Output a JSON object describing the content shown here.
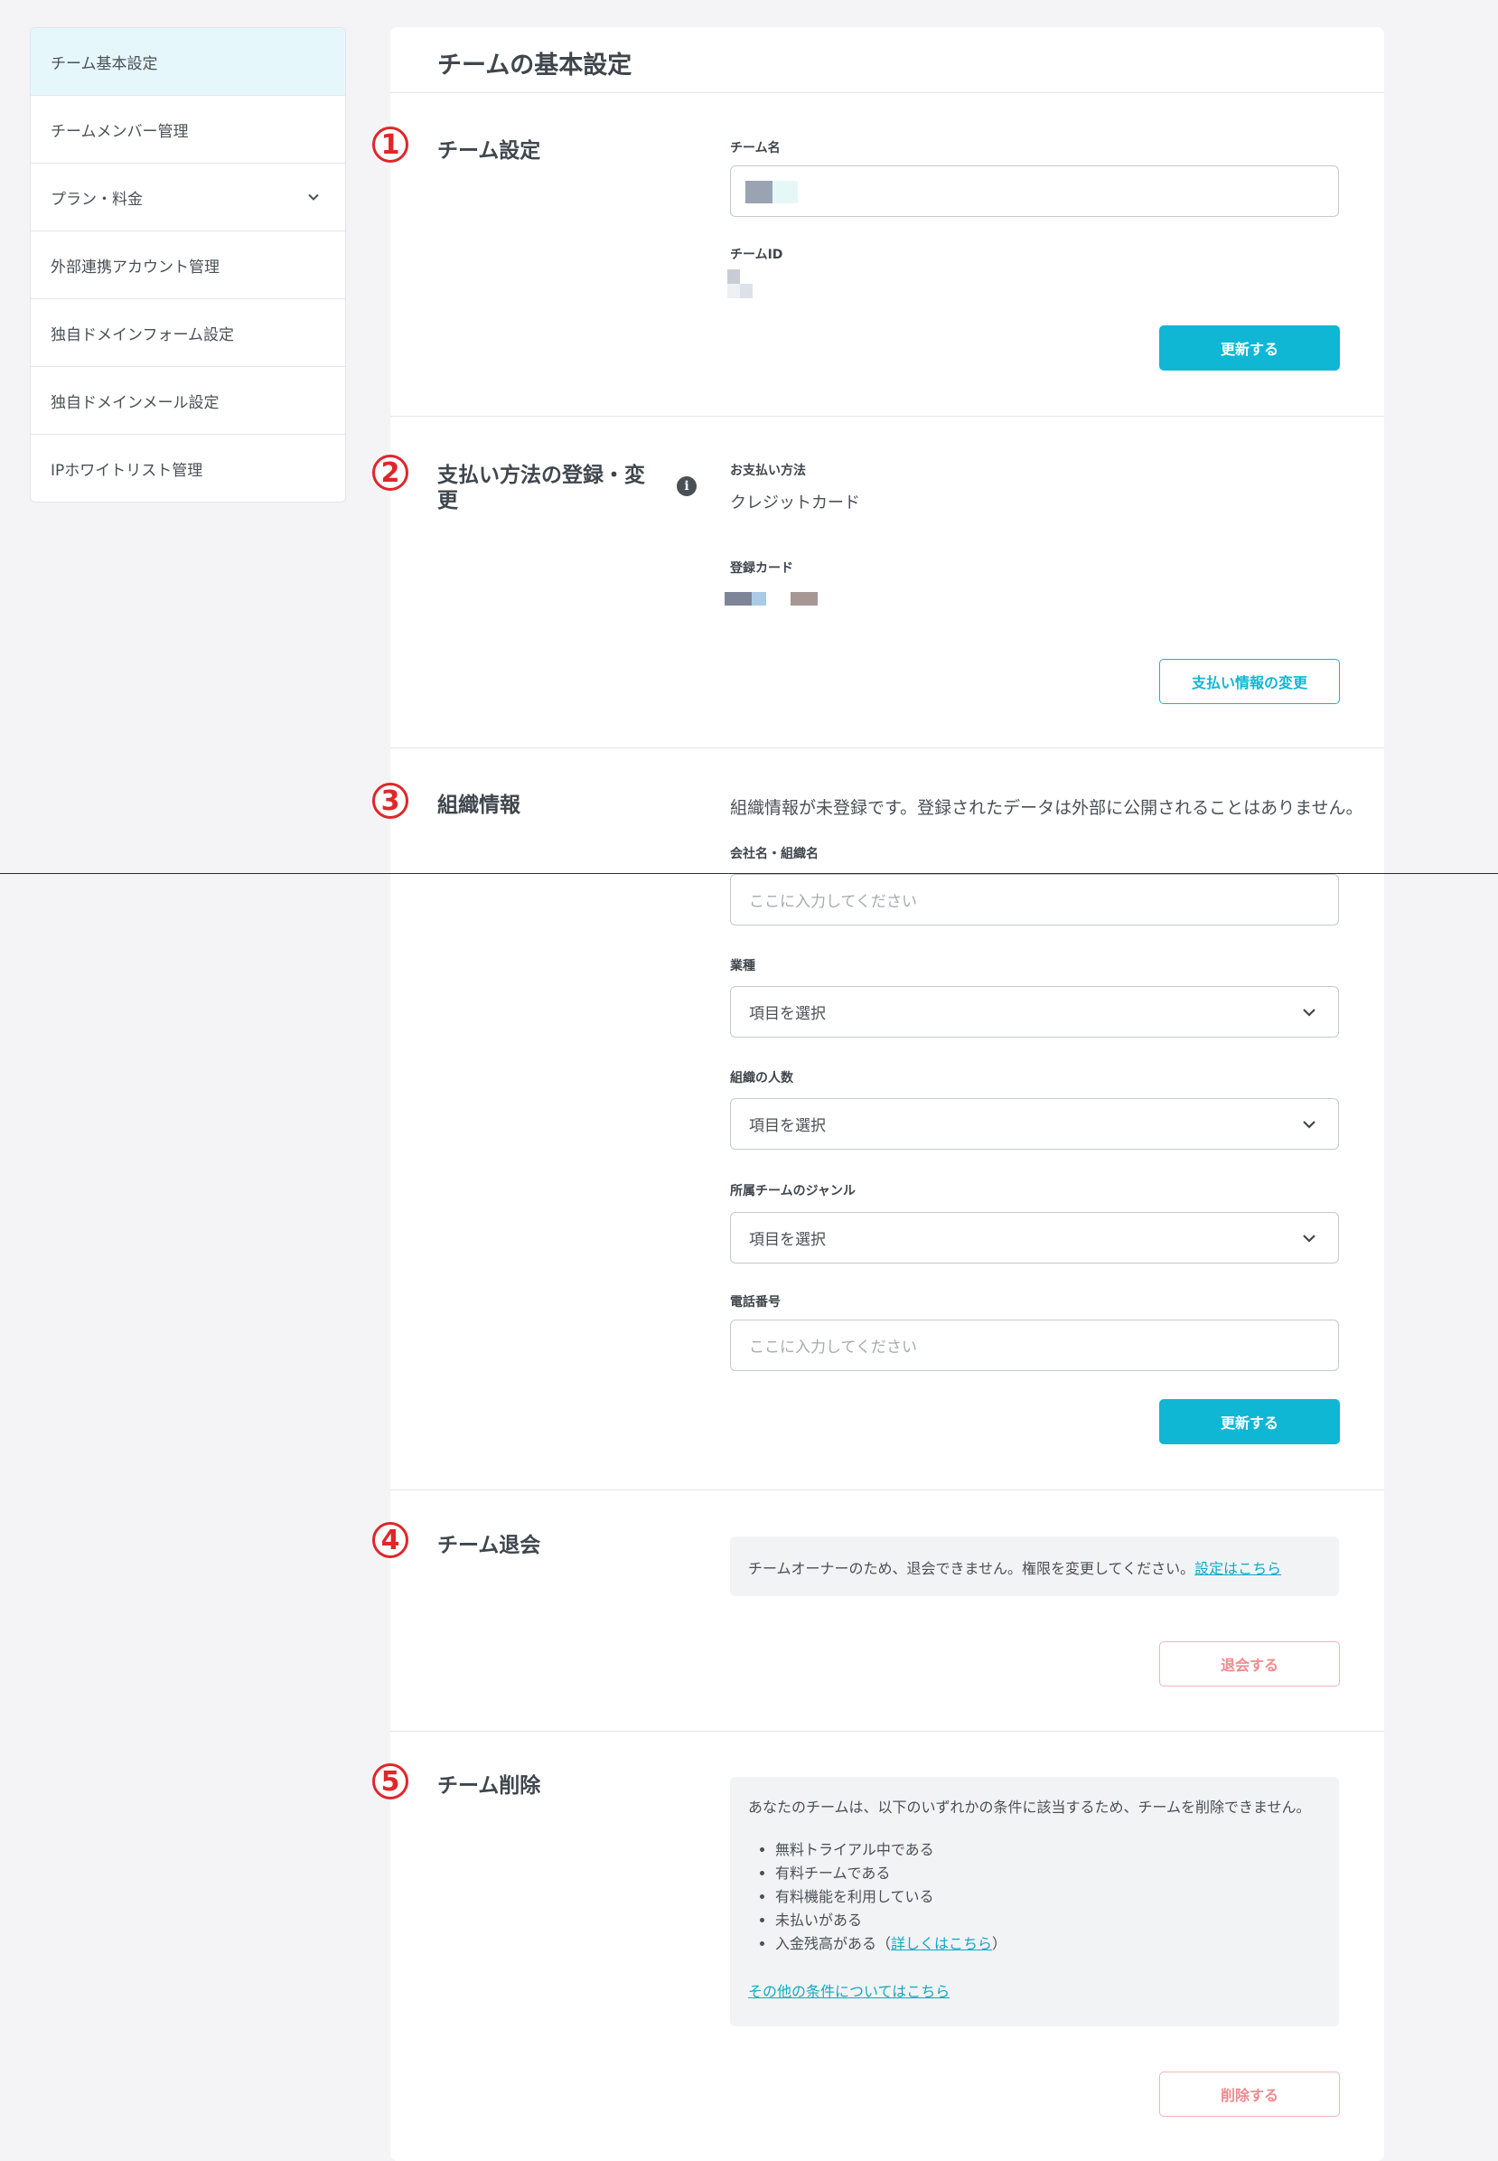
{
  "sidebar": {
    "items": [
      {
        "label": "チーム基本設定"
      },
      {
        "label": "チームメンバー管理"
      },
      {
        "label": "プラン・料金"
      },
      {
        "label": "外部連携アカウント管理"
      },
      {
        "label": "独自ドメインフォーム設定"
      },
      {
        "label": "独自ドメインメール設定"
      },
      {
        "label": "IPホワイトリスト管理"
      }
    ]
  },
  "page_title": "チームの基本設定",
  "markers": [
    "1",
    "2",
    "3",
    "4",
    "5"
  ],
  "team_settings": {
    "heading": "チーム設定",
    "name_label": "チーム名",
    "id_label": "チームID",
    "update_button": "更新する"
  },
  "payment": {
    "heading": "支払い方法の登録・変更",
    "info_icon": "i",
    "method_label": "お支払い方法",
    "method_value": "クレジットカード",
    "card_label": "登録カード",
    "change_button": "支払い情報の変更"
  },
  "organization": {
    "heading": "組織情報",
    "description": "組織情報が未登録です。登録されたデータは外部に公開されることはありません。",
    "company_label": "会社名・組織名",
    "company_placeholder": "ここに入力してください",
    "industry_label": "業種",
    "industry_value": "項目を選択",
    "size_label": "組織の人数",
    "size_value": "項目を選択",
    "genre_label": "所属チームのジャンル",
    "genre_value": "項目を選択",
    "phone_label": "電話番号",
    "phone_placeholder": "ここに入力してください",
    "update_button": "更新する"
  },
  "leave": {
    "heading": "チーム退会",
    "notice": "チームオーナーのため、退会できません。権限を変更してください。",
    "notice_link": "設定はこちら",
    "button": "退会する"
  },
  "delete": {
    "heading": "チーム削除",
    "notice": "あなたのチームは、以下のいずれかの条件に該当するため、チームを削除できません。",
    "conditions": [
      "無料トライアル中である",
      "有料チームである",
      "有料機能を利用している",
      "未払いがある",
      "入金残高がある"
    ],
    "detail_link": "詳しくはこちら",
    "other_link": "その他の条件についてはこちら",
    "button": "削除する"
  },
  "colors": {
    "accent": "#0fb7d4",
    "danger": "#f08a8e",
    "marker": "#e0262a",
    "active_bg": "#e6f7fc"
  }
}
